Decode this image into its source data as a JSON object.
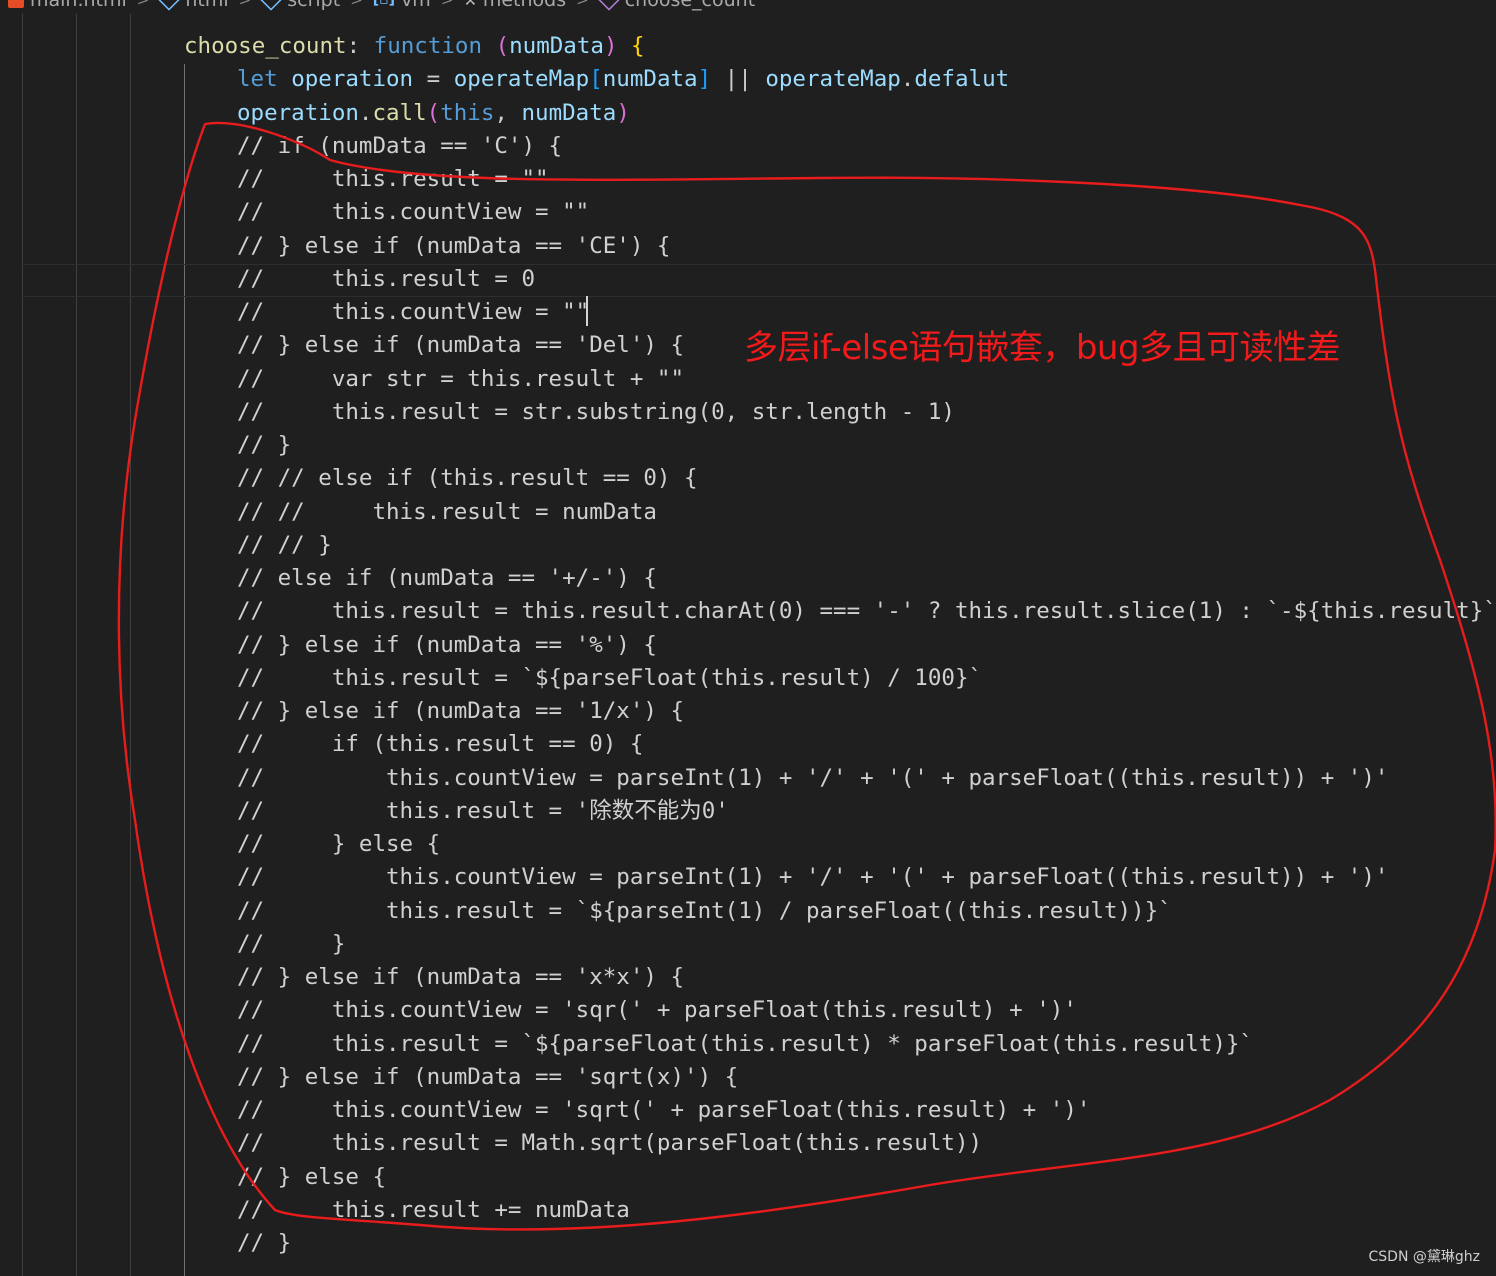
{
  "breadcrumb": {
    "items": [
      {
        "label": "main.html",
        "icon": "html5-icon"
      },
      {
        "label": "html",
        "icon": "element-icon"
      },
      {
        "label": "script",
        "icon": "element-icon"
      },
      {
        "label": "vm",
        "icon": "variable-icon"
      },
      {
        "label": "methods",
        "icon": "wrench-icon"
      },
      {
        "label": "choose_count",
        "icon": "method-icon"
      }
    ],
    "separator": ">"
  },
  "editor": {
    "lines": [
      "choose_count: function (numData) {",
      "let operation = operateMap[numData] || operateMap.defalut",
      "operation.call(this, numData)",
      "// if (numData == 'C') {",
      "//     this.result = \"\"",
      "//     this.countView = \"\"",
      "// } else if (numData == 'CE') {",
      "//     this.result = 0",
      "//     this.countView = \"\"",
      "// } else if (numData == 'Del') {",
      "//     var str = this.result + \"\"",
      "//     this.result = str.substring(0, str.length - 1)",
      "// }",
      "// // else if (this.result == 0) {",
      "// //     this.result = numData",
      "// // }",
      "// else if (numData == '+/-') {",
      "//     this.result = this.result.charAt(0) === '-' ? this.result.slice(1) : `-${this.result}`",
      "// } else if (numData == '%') {",
      "//     this.result = `${parseFloat(this.result) / 100}`",
      "// } else if (numData == '1/x') {",
      "//     if (this.result == 0) {",
      "//         this.countView = parseInt(1) + '/' + '(' + parseFloat((this.result)) + ')'",
      "//         this.result = '除数不能为0'",
      "//     } else {",
      "//         this.countView = parseInt(1) + '/' + '(' + parseFloat((this.result)) + ')'",
      "//         this.result = `${parseInt(1) / parseFloat((this.result))}`",
      "//     }",
      "// } else if (numData == 'x*x') {",
      "//     this.countView = 'sqr(' + parseFloat(this.result) + ')'",
      "//     this.result = `${parseFloat(this.result) * parseFloat(this.result)}`",
      "// } else if (numData == 'sqrt(x)') {",
      "//     this.countView = 'sqrt(' + parseFloat(this.result) + ')'",
      "//     this.result = Math.sqrt(parseFloat(this.result))",
      "// } else {",
      "//     this.result += numData",
      "// }"
    ]
  },
  "annotation": {
    "text": "多层if-else语句嵌套，bug多且可读性差",
    "color": "#f21a1a"
  },
  "watermark": "CSDN @黛琳ghz",
  "colors": {
    "background": "#1f1f1f",
    "keyword": "#569cd6",
    "variable": "#9cdcfe",
    "function": "#dcdcaa",
    "comment": "#d0d0d0",
    "bracket_gold": "#ffd700",
    "bracket_purple": "#da70d6",
    "bracket_blue": "#179fff"
  }
}
